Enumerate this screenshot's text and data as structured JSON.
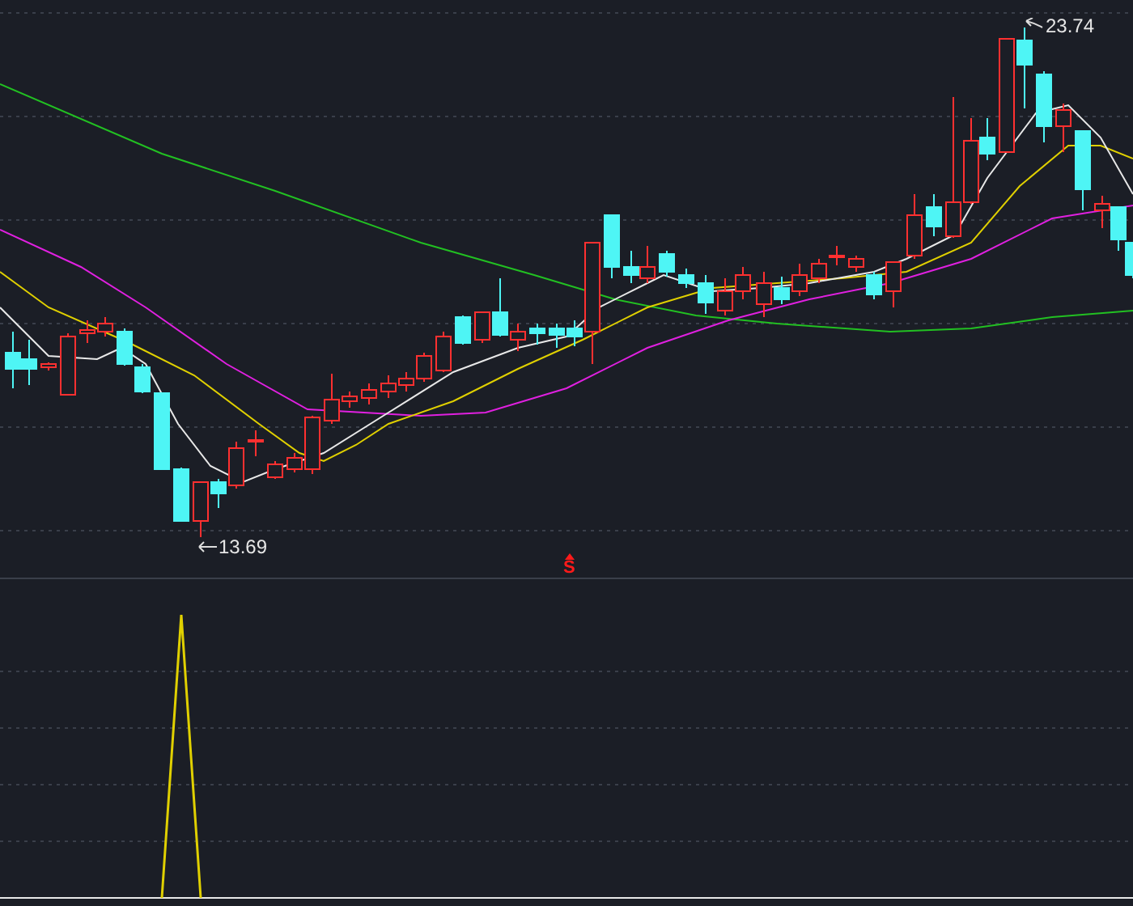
{
  "price_panel": {
    "high_label": "23.74",
    "low_label": "13.69",
    "signal": {
      "label": "S"
    }
  }
}
